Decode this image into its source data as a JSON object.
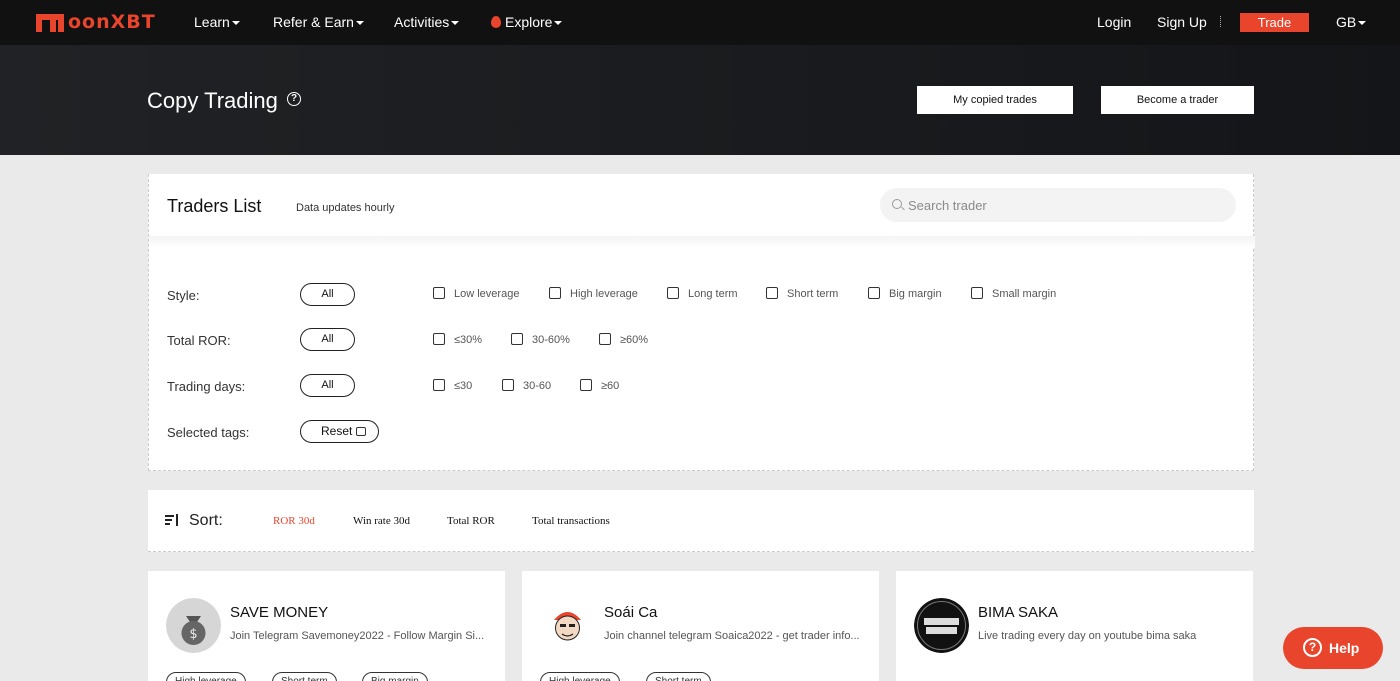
{
  "brand": {
    "logo_text": "oonXBT",
    "accent": "#e8452c"
  },
  "nav": {
    "items": [
      {
        "label": "Learn"
      },
      {
        "label": "Refer & Earn"
      },
      {
        "label": "Activities"
      },
      {
        "label": "Explore"
      }
    ],
    "login": "Login",
    "signup": "Sign Up",
    "trade": "Trade",
    "region": "GB"
  },
  "hero": {
    "title": "Copy Trading",
    "help_glyph": "?",
    "my_copied_trades": "My copied trades",
    "become_trader": "Become a trader"
  },
  "traders": {
    "title": "Traders List",
    "subtitle": "Data updates hourly",
    "search_placeholder": "Search trader"
  },
  "filters": {
    "style": {
      "label": "Style:",
      "all": "All",
      "options": [
        "Low leverage",
        "High leverage",
        "Long term",
        "Short term",
        "Big margin",
        "Small margin"
      ]
    },
    "ror": {
      "label": "Total ROR:",
      "all": "All",
      "options": [
        "≤30%",
        "30-60%",
        "≥60%"
      ]
    },
    "days": {
      "label": "Trading days:",
      "all": "All",
      "options": [
        "≤30",
        "30-60",
        "≥60"
      ]
    },
    "selected": {
      "label": "Selected tags:",
      "reset": "Reset"
    }
  },
  "sort": {
    "label": "Sort:",
    "options": [
      "ROR 30d",
      "Win rate 30d",
      "Total ROR",
      "Total transactions"
    ],
    "active": "ROR 30d"
  },
  "cards": [
    {
      "name": "SAVE MONEY",
      "desc": "Join Telegram Savemoney2022 - Follow Margin Si...",
      "tags": [
        "High leverage",
        "Short term",
        "Big margin"
      ]
    },
    {
      "name": "Soái Ca",
      "desc": "Join channel telegram Soaica2022 - get trader info...",
      "tags": [
        "High leverage",
        "Short term"
      ]
    },
    {
      "name": "BIMA SAKA",
      "desc": "Live trading every day on youtube bima saka",
      "tags": []
    }
  ],
  "help": {
    "label": "Help",
    "glyph": "?"
  }
}
